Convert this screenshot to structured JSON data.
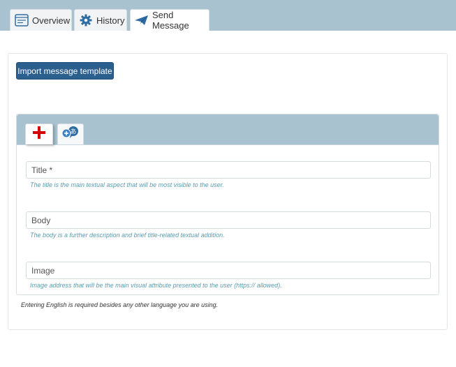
{
  "tabs": {
    "overview": "Overview",
    "history": "History",
    "send_message": "Send Message"
  },
  "import_button": "Import message template",
  "language_tabs": {
    "add_language_icon_glyph": "あ"
  },
  "fields": {
    "title": {
      "placeholder": "Title *",
      "hint": "The title is the main textual aspect that will be most visible to the user."
    },
    "body": {
      "placeholder": "Body",
      "hint": "The body is a further description and brief title-related textual addition."
    },
    "image": {
      "placeholder": "Image",
      "hint": "Image address that will be the main visual attribute presented to the user (https:// allowed)."
    }
  },
  "footer_note": "Entering English is required besides any other language you are using.",
  "colors": {
    "header_bg": "#a9c2d0",
    "primary_button": "#2b5f8e",
    "hint_text": "#5a9bb0",
    "tab_icon_blue": "#2e6da4",
    "english_flag_red": "#d40000"
  }
}
